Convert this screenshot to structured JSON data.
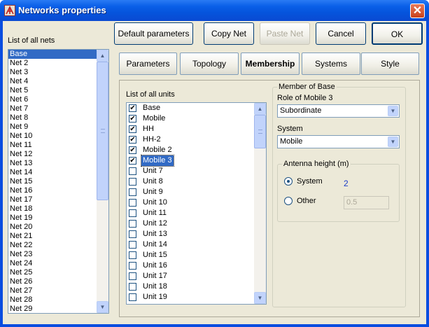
{
  "window": {
    "title": "Networks properties",
    "app_icon": "network-app-icon",
    "close_glyph": "✕"
  },
  "buttons": {
    "default_params": "Default parameters",
    "copy_net": "Copy Net",
    "paste_net": "Paste Net",
    "cancel": "Cancel",
    "ok": "OK"
  },
  "tabs": [
    "Parameters",
    "Topology",
    "Membership",
    "Systems",
    "Style"
  ],
  "active_tab": "Membership",
  "nets": {
    "label": "List of all nets",
    "items": [
      "Base",
      "Net  2",
      "Net  3",
      "Net  4",
      "Net  5",
      "Net  6",
      "Net  7",
      "Net  8",
      "Net  9",
      "Net 10",
      "Net 11",
      "Net 12",
      "Net 13",
      "Net 14",
      "Net 15",
      "Net 16",
      "Net 17",
      "Net 18",
      "Net 19",
      "Net 20",
      "Net 21",
      "Net 22",
      "Net 23",
      "Net 24",
      "Net 25",
      "Net 26",
      "Net 27",
      "Net 28",
      "Net 29"
    ],
    "selected": "Base"
  },
  "units": {
    "label": "List of all units",
    "items": [
      {
        "name": "Base",
        "checked": true
      },
      {
        "name": "Mobile",
        "checked": true
      },
      {
        "name": "HH",
        "checked": true
      },
      {
        "name": "HH-2",
        "checked": true
      },
      {
        "name": "Mobile 2",
        "checked": true
      },
      {
        "name": "Mobile 3",
        "checked": true,
        "selected": true
      },
      {
        "name": "Unit   7",
        "checked": false
      },
      {
        "name": "Unit   8",
        "checked": false
      },
      {
        "name": "Unit   9",
        "checked": false
      },
      {
        "name": "Unit  10",
        "checked": false
      },
      {
        "name": "Unit  11",
        "checked": false
      },
      {
        "name": "Unit  12",
        "checked": false
      },
      {
        "name": "Unit  13",
        "checked": false
      },
      {
        "name": "Unit  14",
        "checked": false
      },
      {
        "name": "Unit  15",
        "checked": false
      },
      {
        "name": "Unit  16",
        "checked": false
      },
      {
        "name": "Unit  17",
        "checked": false
      },
      {
        "name": "Unit  18",
        "checked": false
      },
      {
        "name": "Unit  19",
        "checked": false
      }
    ]
  },
  "member": {
    "group_title": "Member of Base",
    "role_label": "Role of Mobile 3",
    "role_value": "Subordinate",
    "system_label": "System",
    "system_value": "Mobile",
    "antenna": {
      "group_title": "Antenna height (m)",
      "option_system": "System",
      "option_other": "Other",
      "system_value": "2",
      "other_value": "0.5",
      "selected": "System"
    }
  },
  "colors": {
    "selection": "#316ac5",
    "titlebar": "#0a5fe8",
    "dialog_bg": "#ece9d8",
    "value_text": "#1c3cc8"
  }
}
